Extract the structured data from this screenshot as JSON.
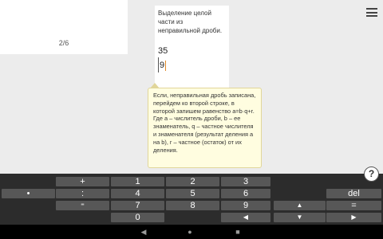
{
  "pager": {
    "text": "2/6"
  },
  "work": {
    "title": "Выделение целой части из неправильной дроби.",
    "numerator": "35",
    "denominator": "9"
  },
  "tooltip": {
    "text": "Если, неправильная дробь записана, перейдем ко второй строке, в которой запишем равенство a=b·q+r. Где a – числитель дроби, b – ее знаменатель, q – частное числителя и знаменателя (результат деления a на b), r – частное (остаток) от их деления."
  },
  "help": {
    "label": "?"
  },
  "keyboard": {
    "row1": {
      "plus": "+",
      "k1": "1",
      "k2": "2",
      "k3": "3"
    },
    "row2": {
      "dot": "•",
      "colon": ":",
      "k4": "4",
      "k5": "5",
      "k6": "6",
      "del": "del"
    },
    "row3": {
      "fraction": "⁼",
      "k7": "7",
      "k8": "8",
      "k9": "9",
      "up": "▲",
      "equals": "="
    },
    "row4": {
      "k0": "0",
      "left": "◀",
      "down": "▼",
      "right": "▶"
    }
  },
  "navbar": {
    "back": "◀",
    "home": "●",
    "recent": "■"
  }
}
